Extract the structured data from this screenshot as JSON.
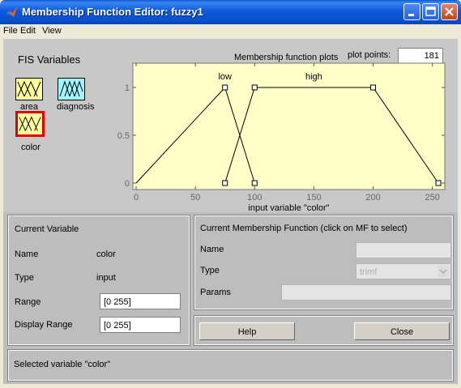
{
  "window": {
    "title": "Membership Function Editor: fuzzy1"
  },
  "menu": {
    "items": [
      "File",
      "Edit",
      "View"
    ]
  },
  "fis_variables": {
    "heading": "FIS Variables",
    "inputs": [
      {
        "label": "area"
      },
      {
        "label": "color",
        "selected": true
      }
    ],
    "outputs": [
      {
        "label": "diagnosis"
      }
    ]
  },
  "plot": {
    "title": "Membership function plots",
    "plot_points_label": "plot points:",
    "plot_points_value": "181",
    "xlabel": "input variable \"color\""
  },
  "chart_data": {
    "type": "line",
    "title": "Membership function plots",
    "xlabel": "input variable \"color\"",
    "ylabel": "",
    "xlim": [
      0,
      255
    ],
    "ylim": [
      0,
      1.1
    ],
    "x_ticks": [
      0,
      50,
      100,
      150,
      200,
      250
    ],
    "y_ticks": [
      0,
      0.5,
      1
    ],
    "series": [
      {
        "name": "low",
        "type": "trimf",
        "x": [
          0,
          75,
          100
        ],
        "y": [
          0,
          1,
          0
        ]
      },
      {
        "name": "high",
        "type": "trapmf",
        "x": [
          75,
          100,
          200,
          255
        ],
        "y": [
          0,
          1,
          1,
          0
        ]
      }
    ],
    "colors": {
      "line": "#000000",
      "background": "#ffffc8"
    }
  },
  "current_variable": {
    "heading": "Current Variable",
    "name_label": "Name",
    "name_value": "color",
    "type_label": "Type",
    "type_value": "input",
    "range_label": "Range",
    "range_value": "[0 255]",
    "display_range_label": "Display Range",
    "display_range_value": "[0 255]"
  },
  "current_mf": {
    "heading": "Current Membership Function (click on MF to select)",
    "name_label": "Name",
    "name_value": "",
    "type_label": "Type",
    "type_value": "trimf",
    "params_label": "Params",
    "params_value": ""
  },
  "buttons": {
    "help": "Help",
    "close": "Close"
  },
  "status": {
    "text": "Selected variable \"color\""
  },
  "colors": {
    "title_bar": "#0a58d8",
    "plot_bg": "#ffffc8",
    "input_tile": "#ffff9c",
    "output_tile": "#9ff7ff",
    "selection": "#e00000",
    "figure_bg": "#c8c8c8"
  }
}
